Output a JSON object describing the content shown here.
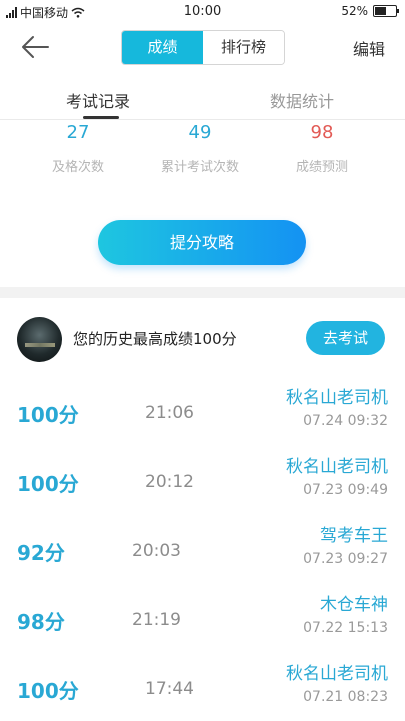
{
  "status_bar": {
    "carrier": "中国移动",
    "time": "10:00",
    "battery": "52%"
  },
  "header": {
    "seg_score": "成绩",
    "seg_rank": "排行榜",
    "edit": "编辑"
  },
  "tabs": {
    "records": "考试记录",
    "stats": "数据统计"
  },
  "stats": [
    {
      "value": "27",
      "label": "及格次数",
      "color": "#29a8d4"
    },
    {
      "value": "49",
      "label": "累计考试次数",
      "color": "#29a8d4"
    },
    {
      "value": "98",
      "label": "成绩预测",
      "color": "#e25a55"
    }
  ],
  "cta": "提分攻略",
  "best": {
    "text": "您的历史最高成绩100分",
    "button": "去考试"
  },
  "records": [
    {
      "score": "100分",
      "duration": "21:06",
      "name": "秋名山老司机",
      "date": "07.24  09:32"
    },
    {
      "score": "100分",
      "duration": "20:12",
      "name": "秋名山老司机",
      "date": "07.23  09:49"
    },
    {
      "score": "92分",
      "duration": "20:03",
      "name": "驾考车王",
      "date": "07.23  09:27"
    },
    {
      "score": "98分",
      "duration": "21:19",
      "name": "木仓车神",
      "date": "07.22  15:13"
    },
    {
      "score": "100分",
      "duration": "17:44",
      "name": "秋名山老司机",
      "date": "07.21  08:23"
    }
  ]
}
